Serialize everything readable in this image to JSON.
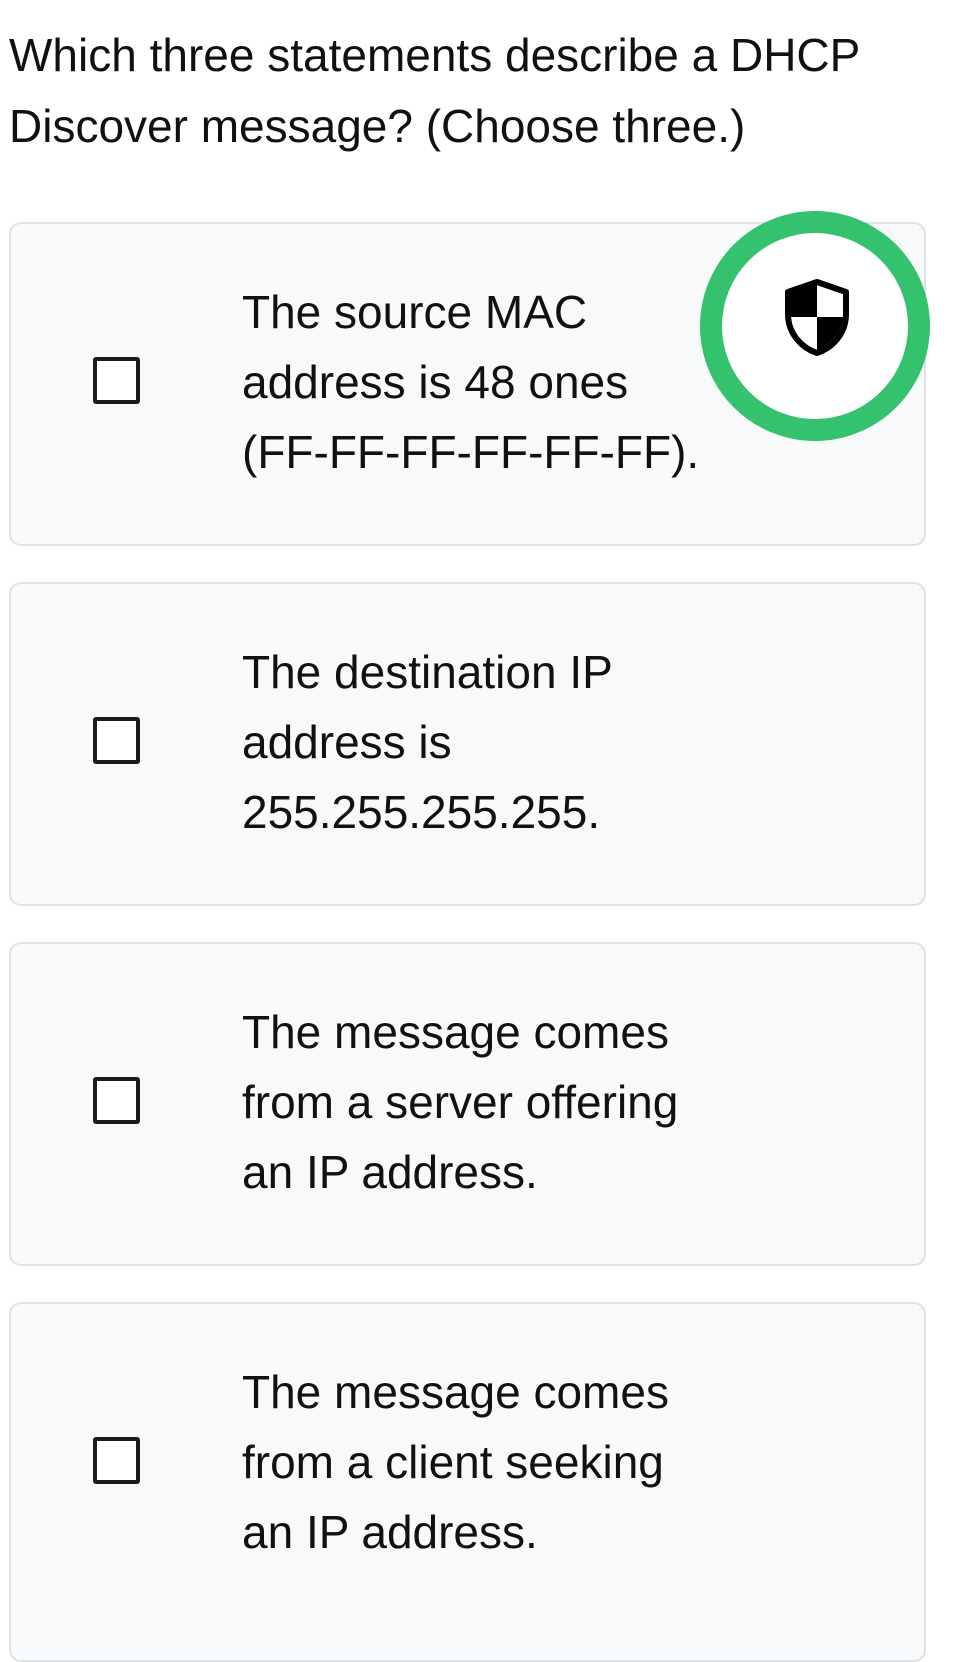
{
  "question": {
    "line1": "Which three statements describe a DHCP",
    "line2": "Discover message? (Choose three.)"
  },
  "options": [
    {
      "lines": [
        "The source MAC",
        "address is 48 ones",
        "(FF-FF-FF-FF-FF-FF)."
      ],
      "checked": false
    },
    {
      "lines": [
        "The destination IP",
        "address is",
        "255.255.255.255."
      ],
      "checked": false
    },
    {
      "lines": [
        "The message comes",
        "from a server offering",
        "an IP address."
      ],
      "checked": false
    },
    {
      "lines": [
        "The message comes",
        "from a client seeking",
        "an IP address."
      ],
      "checked": false
    }
  ],
  "security_badge": {
    "icon": "shield-icon",
    "ring_color": "#34c26f"
  },
  "colors": {
    "card_background": "#f8f9fa",
    "card_border": "#dee2e6",
    "text": "#111111"
  }
}
